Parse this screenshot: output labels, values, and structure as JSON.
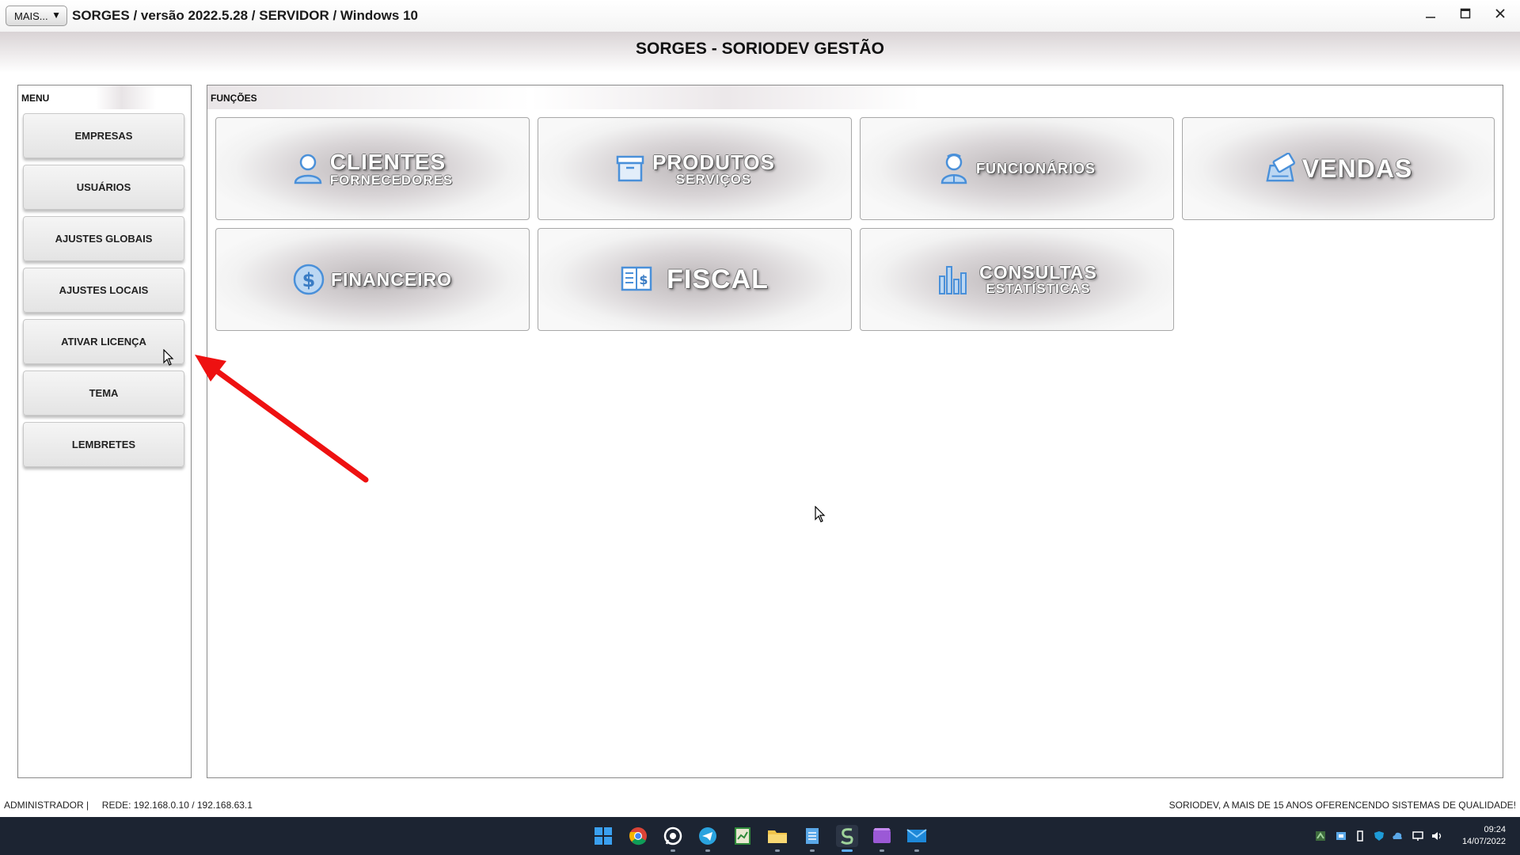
{
  "window": {
    "more_button": "MAIS...",
    "more_arrow": "▼",
    "title": "SORGES / versão 2022.5.28 / SERVIDOR / Windows 10",
    "main_heading": "SORGES - SORIODEV GESTÃO"
  },
  "menu": {
    "header": "MENU",
    "items": [
      {
        "label": "EMPRESAS"
      },
      {
        "label": "USUÁRIOS"
      },
      {
        "label": "AJUSTES GLOBAIS"
      },
      {
        "label": "AJUSTES LOCAIS"
      },
      {
        "label": "ATIVAR LICENÇA"
      },
      {
        "label": "TEMA"
      },
      {
        "label": "LEMBRETES"
      }
    ]
  },
  "functions": {
    "header": "FUNÇÕES",
    "tiles": [
      {
        "main": "CLIENTES",
        "sub": "FORNECEDORES",
        "icon": "person-icon"
      },
      {
        "main": "PRODUTOS",
        "sub": "SERVIÇOS",
        "icon": "box-icon"
      },
      {
        "main": "FUNCIONÁRIOS",
        "sub": "",
        "icon": "employee-icon"
      },
      {
        "main": "VENDAS",
        "sub": "",
        "icon": "cash-register-icon"
      },
      {
        "main": "FINANCEIRO",
        "sub": "",
        "icon": "dollar-coin-icon"
      },
      {
        "main": "FISCAL",
        "sub": "",
        "icon": "receipt-book-icon"
      },
      {
        "main": "CONSULTAS",
        "sub": "ESTATÍSTICAS",
        "icon": "bar-chart-icon"
      }
    ]
  },
  "status": {
    "left": "ADMINISTRADOR |     REDE: 192.168.0.10 / 192.168.63.1",
    "right": "SORIODEV, A MAIS DE 15 ANOS OFERENCENDO SISTEMAS DE QUALIDADE!"
  },
  "taskbar": {
    "apps": [
      "windows-start-icon",
      "chrome-icon",
      "whatsapp-icon",
      "telegram-icon",
      "spreadsheet-icon",
      "file-explorer-icon",
      "notepad-icon",
      "sorges-app-icon",
      "video-editor-icon",
      "mail-icon"
    ],
    "time": "09:24",
    "date": "14/07/2022"
  },
  "colors": {
    "accent_blue": "#4a90d9",
    "annotation_red": "#ee1111",
    "taskbar_bg": "#1c2432"
  }
}
